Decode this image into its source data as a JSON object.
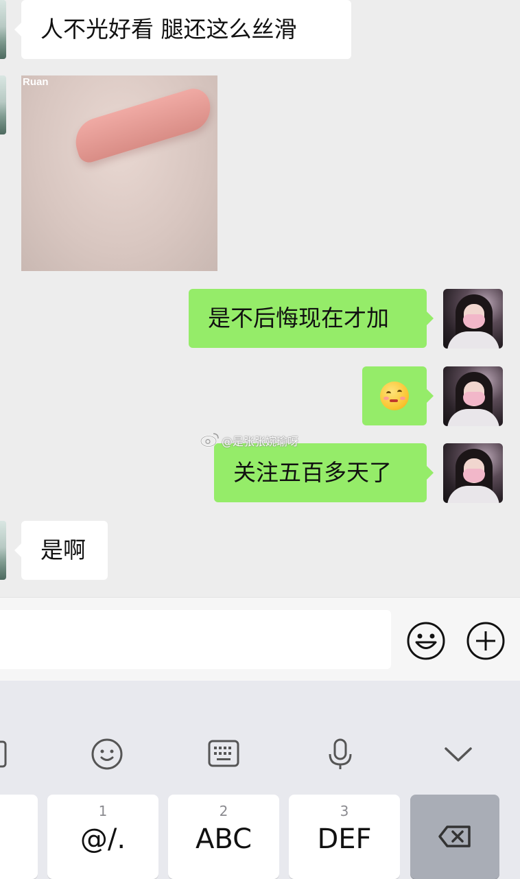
{
  "messages": [
    {
      "side": "left",
      "type": "text",
      "text": "人不光好看  腿还这么丝滑"
    },
    {
      "side": "left",
      "type": "image",
      "watermark": "Ruan"
    },
    {
      "side": "right",
      "type": "text",
      "text": "是不后悔现在才加"
    },
    {
      "side": "right",
      "type": "emoji",
      "emoji": "pensive-blush-emoji"
    },
    {
      "side": "right",
      "type": "text",
      "text": "关注五百多天了"
    },
    {
      "side": "left",
      "type": "text",
      "text": "是啊"
    }
  ],
  "overlay_watermark": "@是张张婉瑜呀",
  "input": {
    "value": "",
    "emoji_button_icon": "smiley-icon",
    "plus_button_icon": "plus-circle-icon"
  },
  "keyboard": {
    "toolbar_icons": [
      "clipboard-icon",
      "emoji-smile-icon",
      "keyboard-icon",
      "microphone-icon",
      "chevron-down-icon"
    ],
    "keys": [
      {
        "num": "1",
        "label": "@/."
      },
      {
        "num": "2",
        "label": "ABC"
      },
      {
        "num": "3",
        "label": "DEF"
      },
      {
        "num": "",
        "label": "",
        "icon": "backspace-icon"
      }
    ]
  },
  "colors": {
    "chat_bg": "#ededed",
    "my_bubble": "#95ec69",
    "their_bubble": "#ffffff",
    "keyboard_bg": "#e8e9ee"
  }
}
